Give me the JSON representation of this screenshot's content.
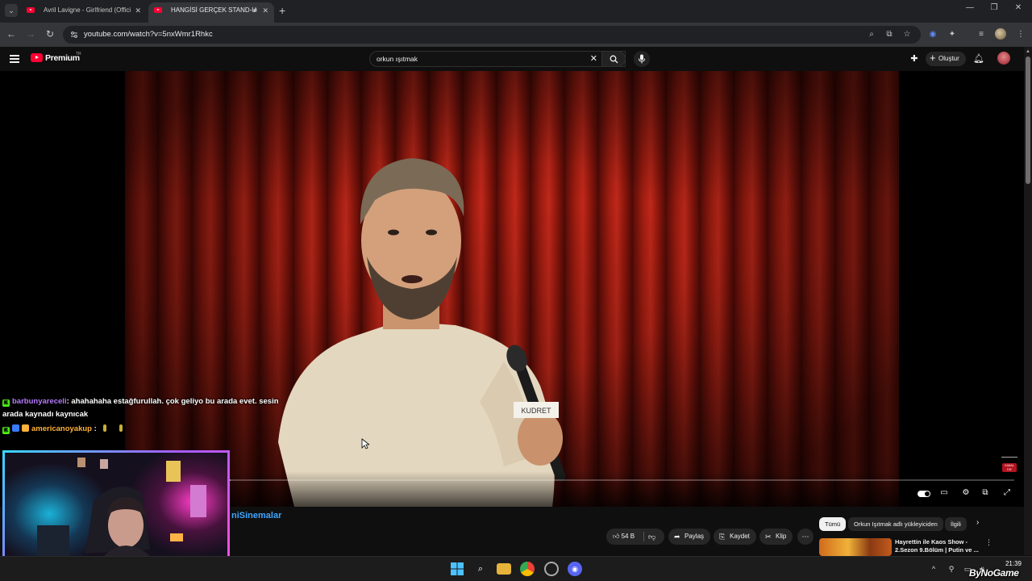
{
  "browser": {
    "tabs": [
      {
        "title": "Avril Lavigne - Girlfriend (Offici",
        "active": false
      },
      {
        "title": "HANGİSİ GERÇEK STAND-U",
        "active": true
      }
    ],
    "url": "youtube.com/watch?v=5nxWmr1Rhkc"
  },
  "youtube": {
    "brand": "Premium",
    "country": "TR",
    "search_query": "orkun ışıtmak",
    "create_label": "Oluştur"
  },
  "video": {
    "progress_fraction": 0.22,
    "name_tag": "KUDRET"
  },
  "chat": {
    "messages": [
      {
        "user": "barbunyareceli",
        "user_color": "#b67aff",
        "text": ": ahahahaha estağfurullah. çok geliyo bu arada evet. sesin",
        "cont": "arada kaynadı kaynıcak"
      },
      {
        "user": "americanoyakup",
        "user_color": "#ffb23a",
        "text": " :",
        "cont": ""
      }
    ]
  },
  "below": {
    "channel": "niSinemalar",
    "likes": "54 B",
    "share": "Paylaş",
    "save": "Kaydet",
    "clip": "Klip",
    "chips": [
      "Tümü",
      "Orkun Işıtmak adlı yükleyiciden",
      "İlgili"
    ],
    "rec_title": "Hayrettin ile Kaos Show - 2.Sezon 9.Bölüm | Putin ve ..."
  },
  "taskbar": {
    "time": "21:39"
  },
  "watermark": "ByNoGame",
  "colors": {
    "accent": "#ff0033",
    "link": "#3ea6ff",
    "kick": "#53fc18"
  }
}
